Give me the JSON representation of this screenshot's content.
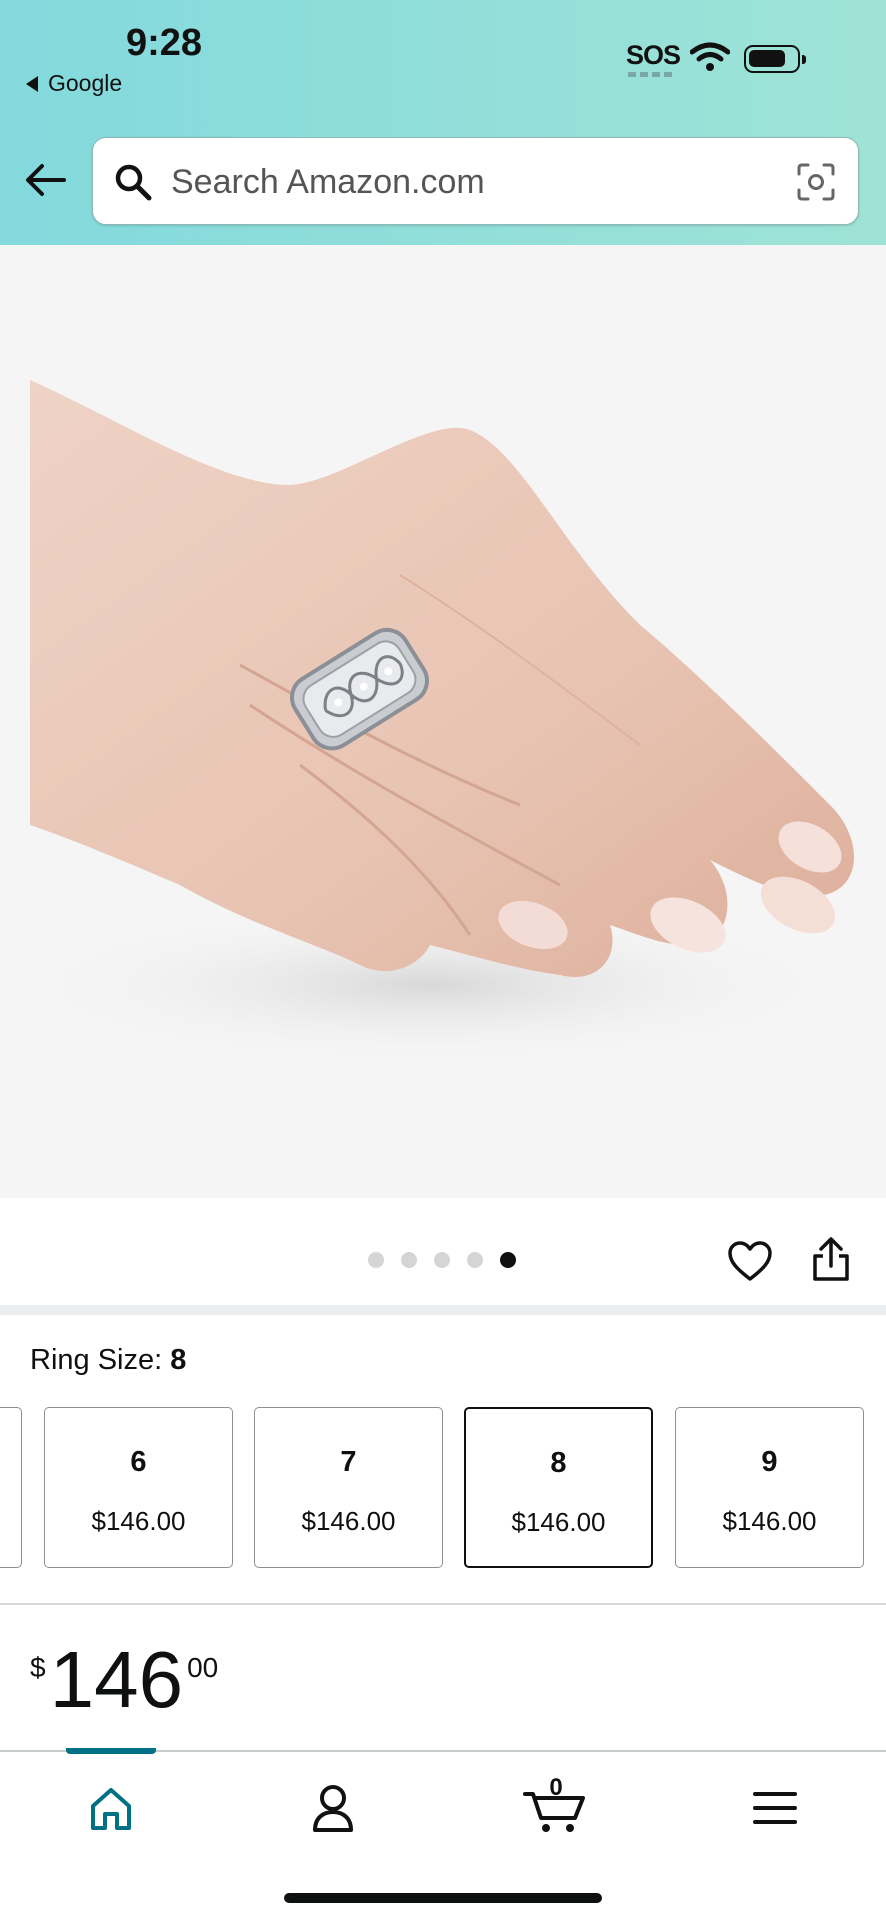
{
  "status_bar": {
    "time": "9:28",
    "back_app_label": "Google",
    "carrier": "SOS"
  },
  "search": {
    "placeholder": "Search Amazon.com",
    "value": ""
  },
  "icons": {
    "back": "arrow-left-icon",
    "search": "magnifier-icon",
    "camera": "camera-scan-icon",
    "wishlist": "heart-icon",
    "share": "share-icon",
    "home": "home-icon",
    "account": "person-icon",
    "cart": "cart-icon",
    "menu": "hamburger-icon"
  },
  "product": {
    "image_count": 5,
    "active_image_index": 4
  },
  "ring_size": {
    "label": "Ring Size:",
    "selected": "8",
    "options": [
      {
        "size": "6",
        "price": "$146.00"
      },
      {
        "size": "7",
        "price": "$146.00"
      },
      {
        "size": "8",
        "price": "$146.00"
      },
      {
        "size": "9",
        "price": "$146.00"
      }
    ]
  },
  "price": {
    "symbol": "$",
    "whole": "146",
    "fraction": "00"
  },
  "tabbar": {
    "active_tab": "home",
    "cart_count": "0"
  },
  "colors": {
    "header_gradient_start": "#83d9dd",
    "header_gradient_end": "#9fe3d6",
    "active_tab": "#007185",
    "text": "#0f1111"
  }
}
